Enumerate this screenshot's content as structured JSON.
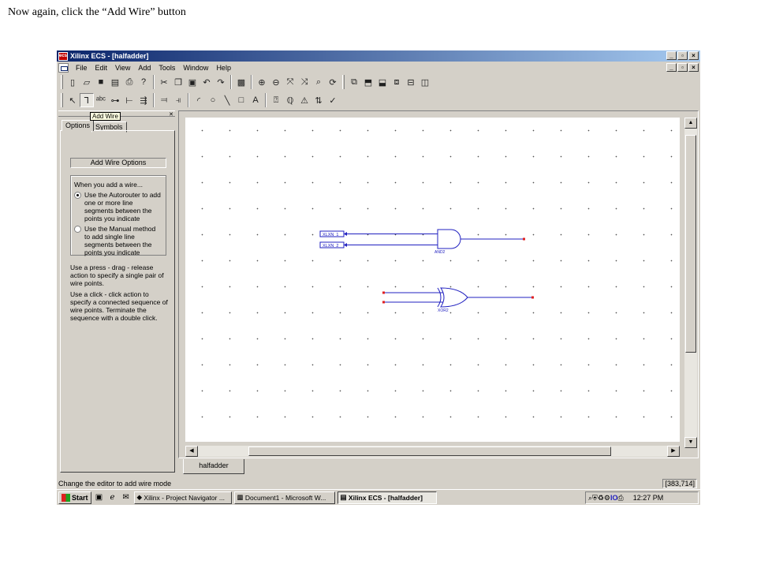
{
  "caption": "Now again, click the “Add Wire” button",
  "window": {
    "app_logo": "ecs",
    "title": "Xilinx ECS - [halfadder]",
    "controls": [
      "_",
      "▫",
      "×"
    ]
  },
  "menu": [
    "File",
    "Edit",
    "View",
    "Add",
    "Tools",
    "Window",
    "Help"
  ],
  "tooltip": "Add Wire",
  "panel": {
    "tabs": [
      "Options",
      "Symbols"
    ],
    "heading": "Add Wire Options",
    "group_title": "When you add a wire...",
    "option1": "Use the Autorouter to add one or more line segments between the points you indicate",
    "option2": "Use the Manual method to add single line segments between the points you indicate",
    "para1": "Use a press - drag - release action to specify a single pair of wire points.",
    "para2": "Use a click - click action to specify a connected sequence of wire points. Terminate the sequence with a double click."
  },
  "schematic": {
    "inputs": [
      "XLXN_1",
      "XLXN_2"
    ],
    "and_label": "AND2",
    "xor_label": "XOR2",
    "wire_color": "#2020c0",
    "pin_color": "#e02020"
  },
  "doc_tab": "halfadder",
  "status": {
    "message": "Change the editor to add wire mode",
    "coords": "[383,714]"
  },
  "taskbar": {
    "start": "Start",
    "tasks": [
      "Xilinx - Project Navigator ...",
      "Document1 - Microsoft W...",
      "Xilinx ECS - [halfadder]"
    ],
    "tray_text": "IO",
    "time": "12:27 PM"
  }
}
